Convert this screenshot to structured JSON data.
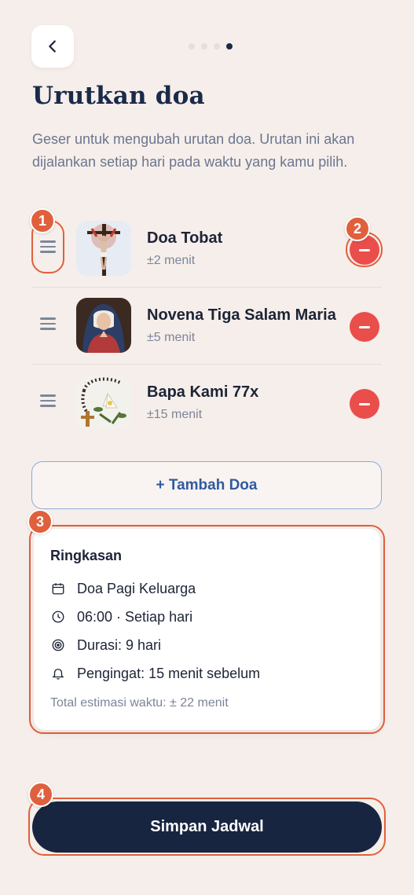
{
  "header": {
    "title": "Urutkan doa",
    "subtitle": "Geser untuk mengubah urutan doa. Urutan ini akan dijalankan setiap hari pada waktu yang kamu pilih.",
    "steps_total": 4,
    "steps_active": 4
  },
  "prayers": [
    {
      "name": "Doa Tobat",
      "duration": "±2 menit",
      "image": "crucifix-image"
    },
    {
      "name": "Novena Tiga Salam Maria",
      "duration": "±5 menit",
      "image": "virgin-mary-image"
    },
    {
      "name": "Bapa Kami 77x",
      "duration": "±15 menit",
      "image": "rosary-lily-image"
    }
  ],
  "add_button": "+ Tambah Doa",
  "summary": {
    "title": "Ringkasan",
    "rows": [
      {
        "icon": "calendar-icon",
        "text": "Doa Pagi Keluarga"
      },
      {
        "icon": "clock-icon",
        "text": "06:00 · Setiap hari"
      },
      {
        "icon": "target-icon",
        "text": "Durasi: 9 hari"
      },
      {
        "icon": "bell-icon",
        "text": "Pengingat: 15 menit sebelum"
      }
    ],
    "total": "Total estimasi waktu: ± 22 menit"
  },
  "save_button": "Simpan Jadwal",
  "annotations": [
    "1",
    "2",
    "3",
    "4"
  ],
  "colors": {
    "background": "#f6eeea",
    "primary": "#172540",
    "danger": "#ea4e4b",
    "annotation": "#e0603d",
    "link": "#2f5aa0"
  }
}
